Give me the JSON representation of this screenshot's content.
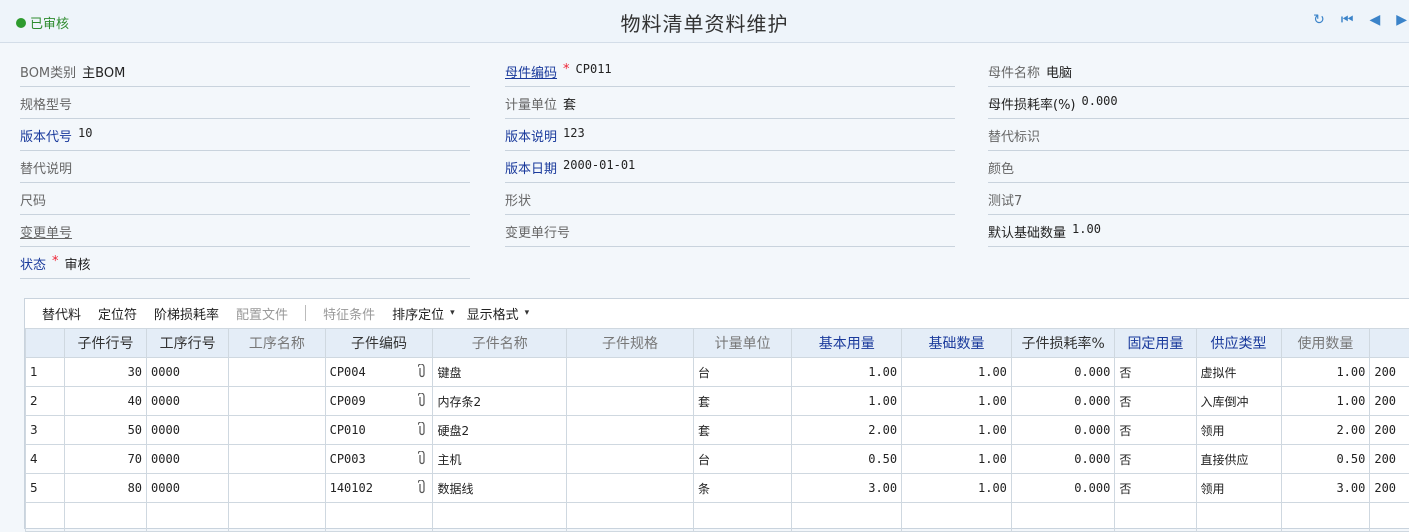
{
  "header": {
    "status": "已审核",
    "title": "物料清单资料维护",
    "nav": {
      "refresh": "↻",
      "first": "⏮",
      "prev": "◀",
      "next": "▶"
    }
  },
  "form": {
    "bom_type": {
      "label": "BOM类别",
      "value": "主BOM"
    },
    "parent_code": {
      "label": "母件编码",
      "value": "CP011"
    },
    "parent_name": {
      "label": "母件名称",
      "value": "电脑"
    },
    "spec": {
      "label": "规格型号",
      "value": ""
    },
    "unit": {
      "label": "计量单位",
      "value": "套"
    },
    "parent_loss": {
      "label": "母件损耗率(%)",
      "value": "0.000"
    },
    "version_code": {
      "label": "版本代号",
      "value": "10"
    },
    "version_desc": {
      "label": "版本说明",
      "value": "123"
    },
    "sub_flag": {
      "label": "替代标识",
      "value": ""
    },
    "sub_desc": {
      "label": "替代说明",
      "value": ""
    },
    "version_date": {
      "label": "版本日期",
      "value": "2000-01-01"
    },
    "color": {
      "label": "颜色",
      "value": ""
    },
    "size": {
      "label": "尺码",
      "value": ""
    },
    "shape": {
      "label": "形状",
      "value": ""
    },
    "test7": {
      "label": "测试7",
      "value": ""
    },
    "change_no": {
      "label": "变更单号",
      "value": ""
    },
    "change_line": {
      "label": "变更单行号",
      "value": ""
    },
    "default_qty": {
      "label": "默认基础数量",
      "value": "1.00"
    },
    "status": {
      "label": "状态",
      "value": "审核"
    },
    "required_mark": "*"
  },
  "toolbar": {
    "substitute": "替代料",
    "locator": "定位符",
    "step_loss": "阶梯损耗率",
    "config_file": "配置文件",
    "feature_cond": "特征条件",
    "sort_locate": "排序定位",
    "display_format": "显示格式"
  },
  "grid": {
    "columns": [
      "子件行号",
      "工序行号",
      "工序名称",
      "子件编码",
      "子件名称",
      "子件规格",
      "计量单位",
      "基本用量",
      "基础数量",
      "子件损耗率%",
      "固定用量",
      "供应类型",
      "使用数量"
    ],
    "rows": [
      {
        "idx": "1",
        "line": "30",
        "op": "0000",
        "op_name": "",
        "code": "CP004",
        "name": "键盘",
        "spec": "",
        "unit": "台",
        "base_qty": "1.00",
        "basis_qty": "1.00",
        "loss": "0.000",
        "fixed": "否",
        "supply": "虚拟件",
        "use_qty": "1.00",
        "extra": "200"
      },
      {
        "idx": "2",
        "line": "40",
        "op": "0000",
        "op_name": "",
        "code": "CP009",
        "name": "内存条2",
        "spec": "",
        "unit": "套",
        "base_qty": "1.00",
        "basis_qty": "1.00",
        "loss": "0.000",
        "fixed": "否",
        "supply": "入库倒冲",
        "use_qty": "1.00",
        "extra": "200"
      },
      {
        "idx": "3",
        "line": "50",
        "op": "0000",
        "op_name": "",
        "code": "CP010",
        "name": "硬盘2",
        "spec": "",
        "unit": "套",
        "base_qty": "2.00",
        "basis_qty": "1.00",
        "loss": "0.000",
        "fixed": "否",
        "supply": "领用",
        "use_qty": "2.00",
        "extra": "200"
      },
      {
        "idx": "4",
        "line": "70",
        "op": "0000",
        "op_name": "",
        "code": "CP003",
        "name": "主机",
        "spec": "",
        "unit": "台",
        "base_qty": "0.50",
        "basis_qty": "1.00",
        "loss": "0.000",
        "fixed": "否",
        "supply": "直接供应",
        "use_qty": "0.50",
        "extra": "200"
      },
      {
        "idx": "5",
        "line": "80",
        "op": "0000",
        "op_name": "",
        "code": "140102",
        "name": "数据线",
        "spec": "",
        "unit": "条",
        "base_qty": "3.00",
        "basis_qty": "1.00",
        "loss": "0.000",
        "fixed": "否",
        "supply": "领用",
        "use_qty": "3.00",
        "extra": "200"
      }
    ]
  },
  "icons": {
    "attachment": "paperclip-icon",
    "caret": "▾"
  }
}
